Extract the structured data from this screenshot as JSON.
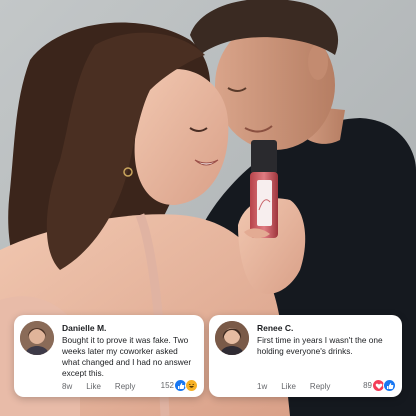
{
  "comments": [
    {
      "name": "Danielle M.",
      "text": "Bought it to prove it was fake. Two weeks later my coworker asked what changed and I had no answer except this.",
      "time": "8w",
      "like_label": "Like",
      "reply_label": "Reply",
      "reaction_count": "152",
      "reactions": [
        "like-icon",
        "haha-icon"
      ]
    },
    {
      "name": "Renee C.",
      "text": "First time in years I wasn't the one holding everyone's drinks.",
      "time": "1w",
      "like_label": "Like",
      "reply_label": "Reply",
      "reaction_count": "89",
      "reactions": [
        "love-icon",
        "like-icon"
      ]
    }
  ],
  "colors": {
    "like_blue": "#1877f2",
    "love_red": "#f33e58",
    "haha_yellow": "#f7b125"
  }
}
